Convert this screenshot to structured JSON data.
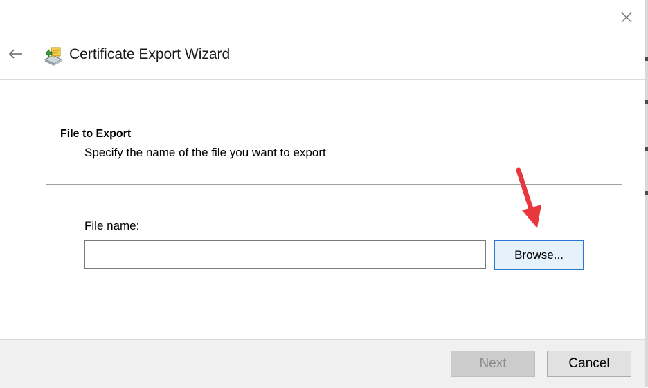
{
  "window": {
    "title": "Certificate Export Wizard",
    "close_icon": "close-icon",
    "back_icon": "back-arrow-icon",
    "title_icon": "certificate-wizard-icon"
  },
  "page": {
    "section_title": "File to Export",
    "section_description": "Specify the name of the file you want to export"
  },
  "form": {
    "file_name_label": "File name:",
    "file_name_value": "",
    "browse_label": "Browse..."
  },
  "annotation": {
    "arrow_icon": "red-arrow-icon",
    "color": "#e8383d"
  },
  "footer": {
    "next_label": "Next",
    "next_enabled": false,
    "cancel_label": "Cancel"
  },
  "colors": {
    "focus_border": "#2a78d6",
    "footer_bg": "#f0f0f0"
  }
}
